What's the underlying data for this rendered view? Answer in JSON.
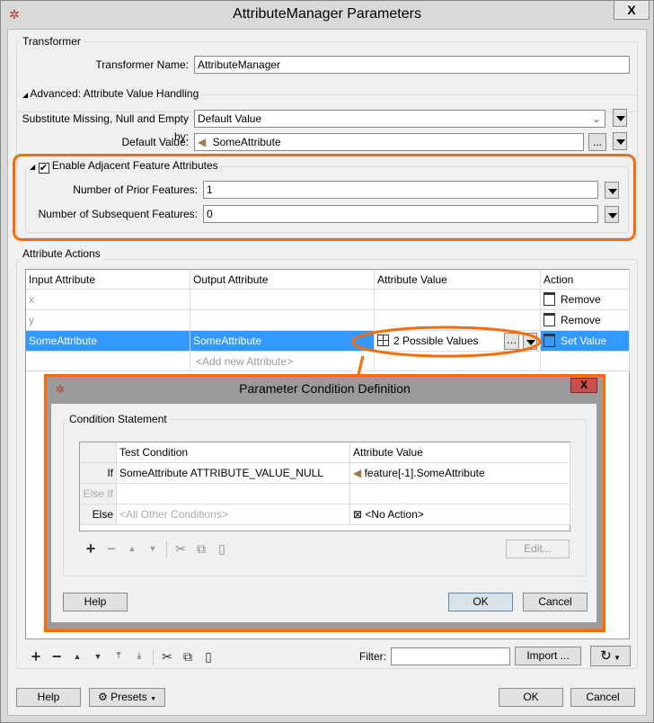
{
  "window": {
    "title": "AttributeManager Parameters",
    "close": "X"
  },
  "transformer": {
    "legend": "Transformer",
    "name_label": "Transformer Name:",
    "name_value": "AttributeManager"
  },
  "advanced": {
    "legend": "Advanced: Attribute Value Handling",
    "substitute_label": "Substitute Missing, Null and Empty by:",
    "substitute_value": "Default Value",
    "default_label": "Default Value:",
    "default_value": "SomeAttribute",
    "ellipsis": "..."
  },
  "adjacent": {
    "legend": "Enable Adjacent Feature Attributes",
    "checked": true,
    "prior_label": "Number of Prior Features:",
    "prior_value": "1",
    "subsequent_label": "Number of Subsequent Features:",
    "subsequent_value": "0"
  },
  "actions": {
    "legend": "Attribute Actions",
    "columns": [
      "Input Attribute",
      "Output Attribute",
      "Attribute Value",
      "Action"
    ],
    "rows": [
      {
        "input": "x",
        "output": "",
        "value": "",
        "action": "Remove"
      },
      {
        "input": "y",
        "output": "",
        "value": "",
        "action": "Remove"
      },
      {
        "input": "SomeAttribute",
        "output": "SomeAttribute",
        "value": "2 Possible Values",
        "action": "Set Value",
        "selected": true
      }
    ],
    "add_new": "<Add new Attribute>",
    "filter_label": "Filter:",
    "filter_value": "",
    "import": "Import ..."
  },
  "subdialog": {
    "title": "Parameter Condition Definition",
    "close": "X",
    "legend": "Condition Statement",
    "columns": [
      "",
      "Test Condition",
      "Attribute Value"
    ],
    "rows": [
      {
        "kind": "If",
        "condition": "SomeAttribute ATTRIBUTE_VALUE_NULL",
        "value": "feature[-1].SomeAttribute"
      },
      {
        "kind": "Else If",
        "condition": "",
        "value": ""
      },
      {
        "kind": "Else",
        "condition": "<All Other Conditions>",
        "value": "<No Action>"
      }
    ],
    "edit": "Edit...",
    "help": "Help",
    "ok": "OK",
    "cancel": "Cancel"
  },
  "footer": {
    "help": "Help",
    "presets": "Presets",
    "ok": "OK",
    "cancel": "Cancel"
  },
  "colors": {
    "accent": "#ff6a00",
    "selection": "#3399ff"
  }
}
